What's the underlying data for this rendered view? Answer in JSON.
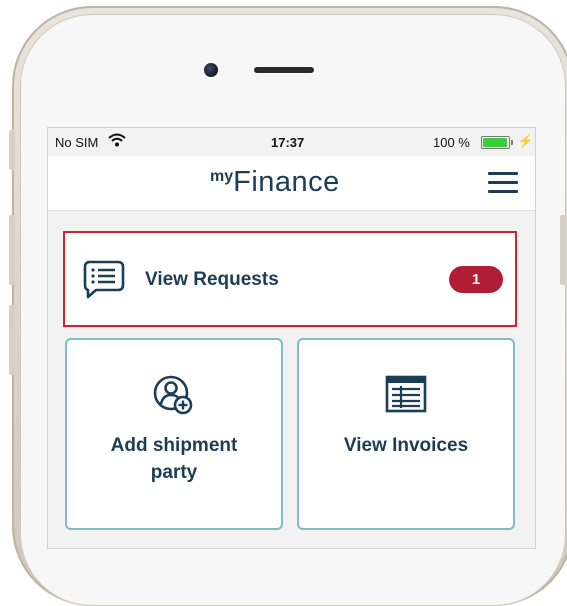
{
  "status_bar": {
    "carrier": "No SIM",
    "time": "17:37",
    "battery_percent": "100 %",
    "battery_level": 1.0
  },
  "header": {
    "logo_prefix": "my",
    "logo_name": "Finance",
    "menu_icon": "hamburger-menu-icon"
  },
  "requests": {
    "label": "View Requests",
    "badge_count": "1",
    "icon": "chat-list-icon"
  },
  "tiles": [
    {
      "label": "Add shipment party",
      "icon": "add-user-icon"
    },
    {
      "label": "View Invoices",
      "icon": "invoice-icon"
    }
  ],
  "colors": {
    "brand_navy": "#1b3d55",
    "badge_red": "#b01d34",
    "highlight_red": "#d2202f",
    "tile_border": "#7fbcc6"
  }
}
